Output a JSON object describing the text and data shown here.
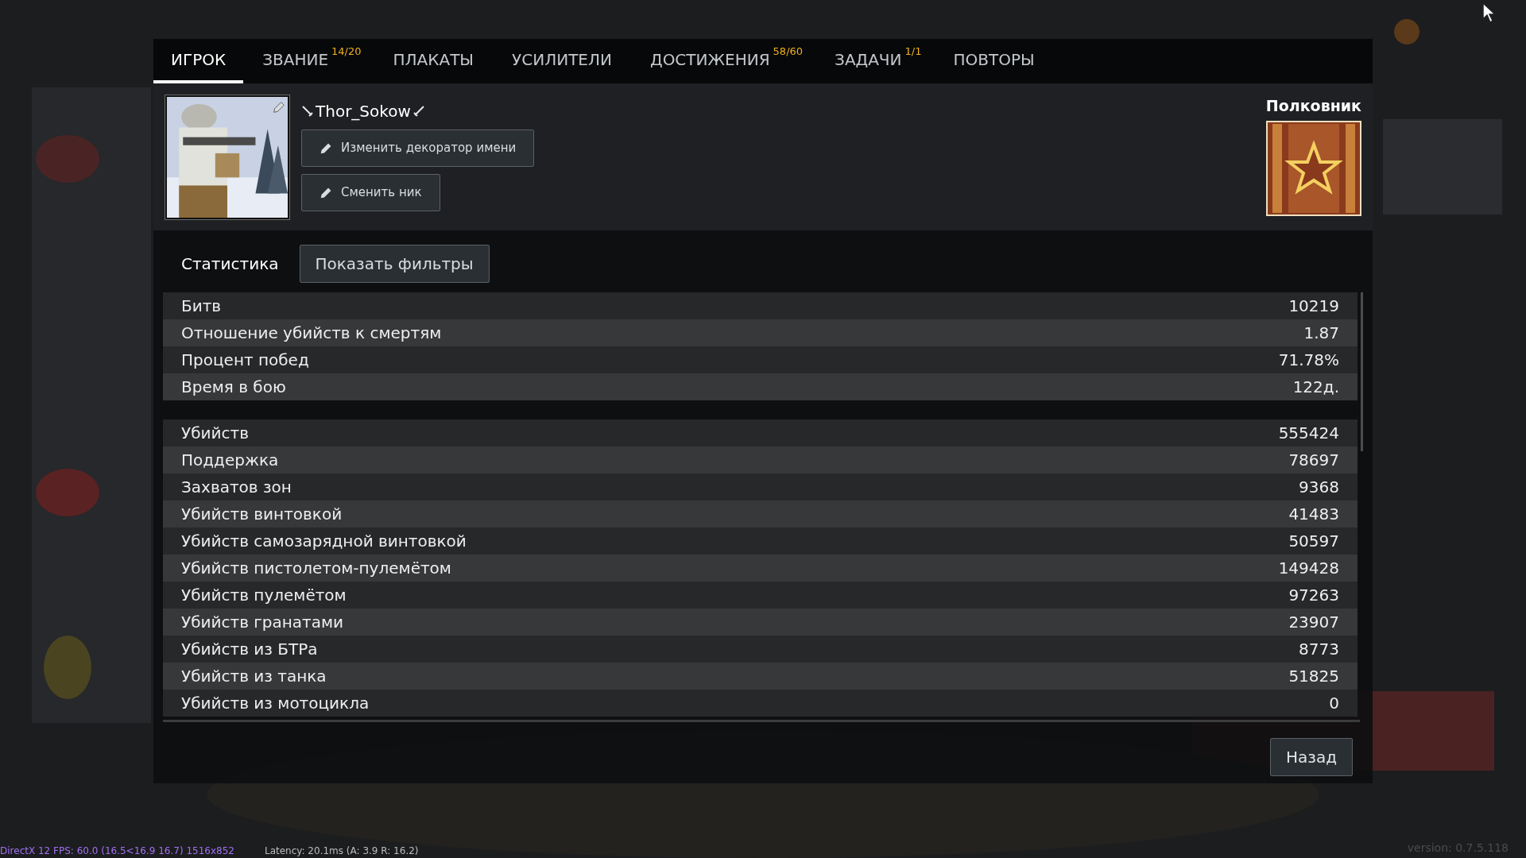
{
  "tabs": [
    {
      "label": "ИГРОК",
      "selected": true
    },
    {
      "label": "ЗВАНИЕ",
      "badge": "14/20",
      "selected": false
    },
    {
      "label": "ПЛАКАТЫ",
      "selected": false
    },
    {
      "label": "УСИЛИТЕЛИ",
      "selected": false
    },
    {
      "label": "ДОСТИЖЕНИЯ",
      "badge": "58/60",
      "selected": false
    },
    {
      "label": "ЗАДАЧИ",
      "badge": "1/1",
      "selected": false
    },
    {
      "label": "ПОВТОРЫ",
      "selected": false
    }
  ],
  "profile": {
    "name": "Thor_Sokow",
    "buttons": [
      "Изменить декоратор имени",
      "Сменить ник"
    ],
    "rank_title": "Полковник"
  },
  "statistics": {
    "title": "Статистика",
    "filter_button": "Показать фильтры",
    "groups": [
      [
        {
          "label": "Битв",
          "value": "10219"
        },
        {
          "label": "Отношение убийств к смертям",
          "value": "1.87"
        },
        {
          "label": "Процент побед",
          "value": "71.78%"
        },
        {
          "label": "Время в бою",
          "value": "122д."
        }
      ],
      [
        {
          "label": "Убийств",
          "value": "555424"
        },
        {
          "label": "Поддержка",
          "value": "78697"
        },
        {
          "label": "Захватов зон",
          "value": "9368"
        },
        {
          "label": "Убийств винтовкой",
          "value": "41483"
        },
        {
          "label": "Убийств самозарядной винтовкой",
          "value": "50597"
        },
        {
          "label": "Убийств пистолетом-пулемётом",
          "value": "149428"
        },
        {
          "label": "Убийств пулемётом",
          "value": "97263"
        },
        {
          "label": "Убийств гранатами",
          "value": "23907"
        },
        {
          "label": "Убийств из БТРа",
          "value": "8773"
        },
        {
          "label": "Убийств из танка",
          "value": "51825"
        },
        {
          "label": "Убийств из мотоцикла",
          "value": "0"
        }
      ]
    ]
  },
  "back_button": "Назад",
  "overlay": {
    "render_stats": "DirectX 12 FPS: 60.0 (16.5<16.9 16.7) 1516x852",
    "latency": "Latency: 20.1ms (A: 3.9 R: 16.2)",
    "version": "version: 0.7.5.118"
  }
}
